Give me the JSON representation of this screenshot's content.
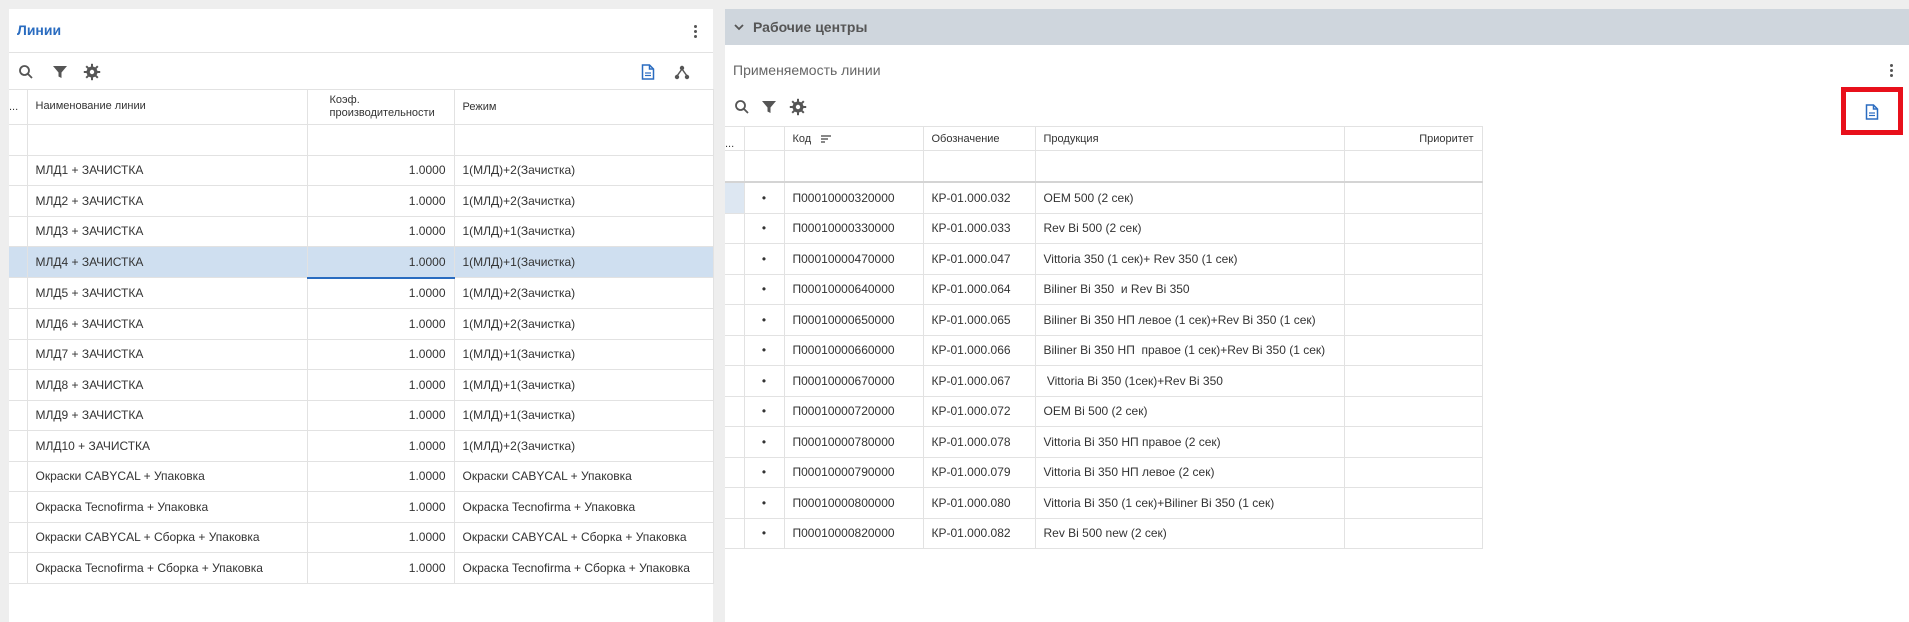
{
  "left_panel": {
    "title": "Линии",
    "columns": {
      "dots": "...",
      "name": "Наименование линии",
      "coef": "Коэф. производительности",
      "mode": "Режим"
    },
    "rows": [
      {
        "name": "МЛД1 + ЗАЧИСТКА",
        "coef": "1.0000",
        "mode": "1(МЛД)+2(Зачистка)"
      },
      {
        "name": "МЛД2 + ЗАЧИСТКА",
        "coef": "1.0000",
        "mode": "1(МЛД)+2(Зачистка)"
      },
      {
        "name": "МЛД3 + ЗАЧИСТКА",
        "coef": "1.0000",
        "mode": "1(МЛД)+1(Зачистка)"
      },
      {
        "name": "МЛД4 + ЗАЧИСТКА",
        "coef": "1.0000",
        "mode": "1(МЛД)+1(Зачистка)"
      },
      {
        "name": "МЛД5 + ЗАЧИСТКА",
        "coef": "1.0000",
        "mode": "1(МЛД)+2(Зачистка)"
      },
      {
        "name": "МЛД6 + ЗАЧИСТКА",
        "coef": "1.0000",
        "mode": "1(МЛД)+2(Зачистка)"
      },
      {
        "name": "МЛД7 + ЗАЧИСТКА",
        "coef": "1.0000",
        "mode": "1(МЛД)+1(Зачистка)"
      },
      {
        "name": "МЛД8 + ЗАЧИСТКА",
        "coef": "1.0000",
        "mode": "1(МЛД)+1(Зачистка)"
      },
      {
        "name": "МЛД9 + ЗАЧИСТКА",
        "coef": "1.0000",
        "mode": "1(МЛД)+1(Зачистка)"
      },
      {
        "name": "МЛД10 + ЗАЧИСТКА",
        "coef": "1.0000",
        "mode": "1(МЛД)+2(Зачистка)"
      },
      {
        "name": "Окраски CABYCAL + Упаковка",
        "coef": "1.0000",
        "mode": "Окраски CABYCAL + Упаковка"
      },
      {
        "name": "Окраска Tecnofirma + Упаковка",
        "coef": "1.0000",
        "mode": "Окраска Tecnofirma + Упаковка"
      },
      {
        "name": "Окраски CABYCAL + Сборка + Упаковка",
        "coef": "1.0000",
        "mode": "Окраски CABYCAL + Сборка + Упаковка"
      },
      {
        "name": "Окраска Tecnofirma + Сборка + Упаковка",
        "coef": "1.0000",
        "mode": "Окраска Tecnofirma + Сборка + Упаковка"
      }
    ],
    "selected_row": 3
  },
  "right_panel": {
    "section_title": "Рабочие центры",
    "subtitle": "Применяемость линии",
    "columns": {
      "dots": "...",
      "code": "Код",
      "designation": "Обозначение",
      "product": "Продукция",
      "priority": "Приоритет"
    },
    "rows": [
      {
        "code": "П00010000320000",
        "designation": "КР-01.000.032",
        "product": "OEM 500 (2 сек)",
        "priority": ""
      },
      {
        "code": "П00010000330000",
        "designation": "КР-01.000.033",
        "product": "Rev Bi 500 (2 сек)",
        "priority": ""
      },
      {
        "code": "П00010000470000",
        "designation": "КР-01.000.047",
        "product": "Vittoria 350 (1 сек)+ Rev 350 (1 сек)",
        "priority": ""
      },
      {
        "code": "П00010000640000",
        "designation": "КР-01.000.064",
        "product": "Biliner Bi 350  и Rev Bi 350",
        "priority": ""
      },
      {
        "code": "П00010000650000",
        "designation": "КР-01.000.065",
        "product": "Biliner Bi 350 НП левое (1 сек)+Rev Bi 350 (1 сек)",
        "priority": ""
      },
      {
        "code": "П00010000660000",
        "designation": "КР-01.000.066",
        "product": "Biliner Bi 350 НП  правое (1 сек)+Rev Bi 350 (1 сек)",
        "priority": ""
      },
      {
        "code": "П00010000670000",
        "designation": "КР-01.000.067",
        "product": " Vittoria Bi 350 (1сек)+Rev Bi 350",
        "priority": ""
      },
      {
        "code": "П00010000720000",
        "designation": "КР-01.000.072",
        "product": "OEM Bi 500 (2 сек)",
        "priority": ""
      },
      {
        "code": "П00010000780000",
        "designation": "КР-01.000.078",
        "product": "Vittoria Bi 350 НП правое (2 сек)",
        "priority": ""
      },
      {
        "code": "П00010000790000",
        "designation": "КР-01.000.079",
        "product": "Vittoria Bi 350 НП левое (2 сек)",
        "priority": ""
      },
      {
        "code": "П00010000800000",
        "designation": "КР-01.000.080",
        "product": "Vittoria Bi 350 (1 сек)+Biliner Bi 350 (1 сек)",
        "priority": ""
      },
      {
        "code": "П00010000820000",
        "designation": "КР-01.000.082",
        "product": "Rev Bi 500 new (2 сек)",
        "priority": ""
      }
    ]
  },
  "icons": {
    "search": "search-icon",
    "filter": "filter-icon",
    "settings": "gear-icon",
    "document": "document-icon",
    "hierarchy": "hierarchy-icon",
    "more": "more-vertical-icon",
    "chevron": "chevron-down-icon",
    "sort": "sort-icon"
  },
  "colors": {
    "accent": "#2a6cc0",
    "selection": "#cfdff0",
    "section_bar": "#cfd6dd",
    "highlight": "#e8101b"
  }
}
